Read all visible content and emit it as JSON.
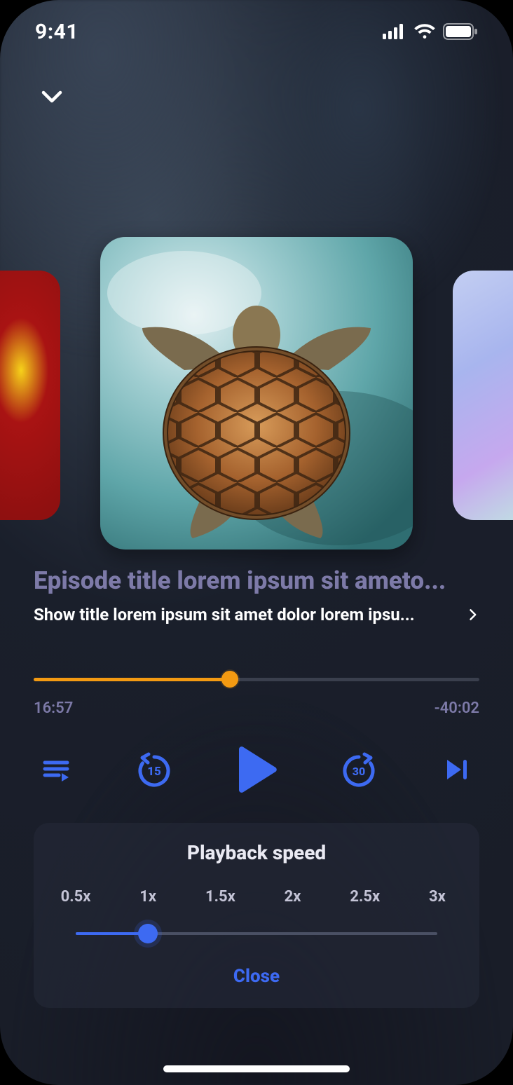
{
  "status_bar": {
    "time": "9:41"
  },
  "titles": {
    "episode": "Episode title lorem ipsum sit ameto...",
    "show": "Show title lorem ipsum sit amet dolor lorem ipsu..."
  },
  "progress": {
    "elapsed": "16:57",
    "remaining": "-40:02",
    "percent": 44
  },
  "controls": {
    "rewind_seconds": "15",
    "forward_seconds": "30"
  },
  "speed_sheet": {
    "title": "Playback speed",
    "options": [
      "0.5x",
      "1x",
      "1.5x",
      "2x",
      "2.5x",
      "3x"
    ],
    "selected_index": 1,
    "close_label": "Close"
  },
  "colors": {
    "accent_blue": "#3d6af2",
    "accent_orange": "#f39a12",
    "muted_purple": "#7d7aa8"
  }
}
